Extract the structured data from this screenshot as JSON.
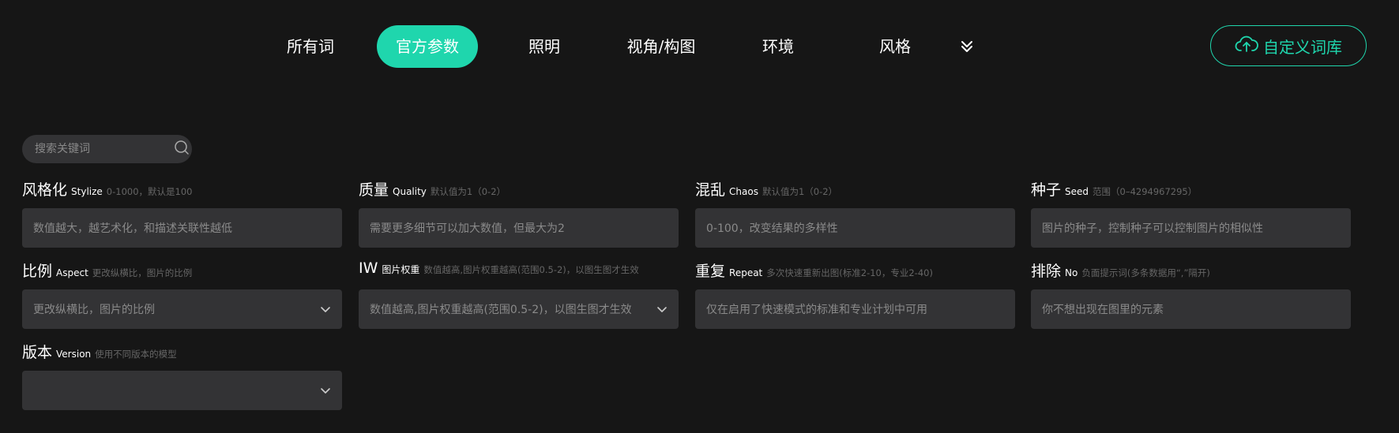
{
  "nav": {
    "tabs": [
      {
        "label": "所有词",
        "active": false
      },
      {
        "label": "官方参数",
        "active": true
      },
      {
        "label": "照明",
        "active": false
      },
      {
        "label": "视角/构图",
        "active": false
      },
      {
        "label": "环境",
        "active": false
      },
      {
        "label": "风格",
        "active": false
      }
    ],
    "more_icon": "double-chevron-down-icon",
    "custom_button": {
      "label": "自定义词库",
      "icon": "cloud-upload-icon"
    }
  },
  "colors": {
    "accent": "#1fd6ad",
    "background": "#161616",
    "input_bg": "#333335"
  },
  "search": {
    "placeholder": "搜索关键词",
    "value": "",
    "icon": "search-icon"
  },
  "fields": [
    {
      "cn": "风格化",
      "en": "Stylize",
      "hint": "0-1000，默认是100",
      "placeholder": "数值越大，越艺术化，和描述关联性越低",
      "type": "input"
    },
    {
      "cn": "质量",
      "en": "Quality",
      "hint": "默认值为1（0-2）",
      "placeholder": "需要更多细节可以加大数值，但最大为2",
      "type": "input"
    },
    {
      "cn": "混乱",
      "en": "Chaos",
      "hint": "默认值为1（0-2）",
      "placeholder": "0-100，改变结果的多样性",
      "type": "input"
    },
    {
      "cn": "种子",
      "en": "Seed",
      "hint": "范围（0–4294967295）",
      "placeholder": "图片的种子，控制种子可以控制图片的相似性",
      "type": "input"
    },
    {
      "cn": "比例",
      "en": "Aspect",
      "hint": "更改纵横比，图片的比例",
      "placeholder": "更改纵横比，图片的比例",
      "type": "select"
    },
    {
      "cn": "IW",
      "en": "图片权重",
      "hint": "数值越高,图片权重越高(范围0.5-2)，以图生图才生效",
      "placeholder": "数值越高,图片权重越高(范围0.5-2)，以图生图才生效",
      "type": "select"
    },
    {
      "cn": "重复",
      "en": "Repeat",
      "hint": "多次快速重新出图(标准2-10，专业2-40)",
      "placeholder": "仅在启用了快速模式的标准和专业计划中可用",
      "type": "input"
    },
    {
      "cn": "排除",
      "en": "No",
      "hint": "负面提示词(多条数据用“,”隔开)",
      "placeholder": "你不想出现在图里的元素",
      "type": "input"
    },
    {
      "cn": "版本",
      "en": "Version",
      "hint": "使用不同版本的模型",
      "placeholder": "",
      "type": "select"
    }
  ]
}
